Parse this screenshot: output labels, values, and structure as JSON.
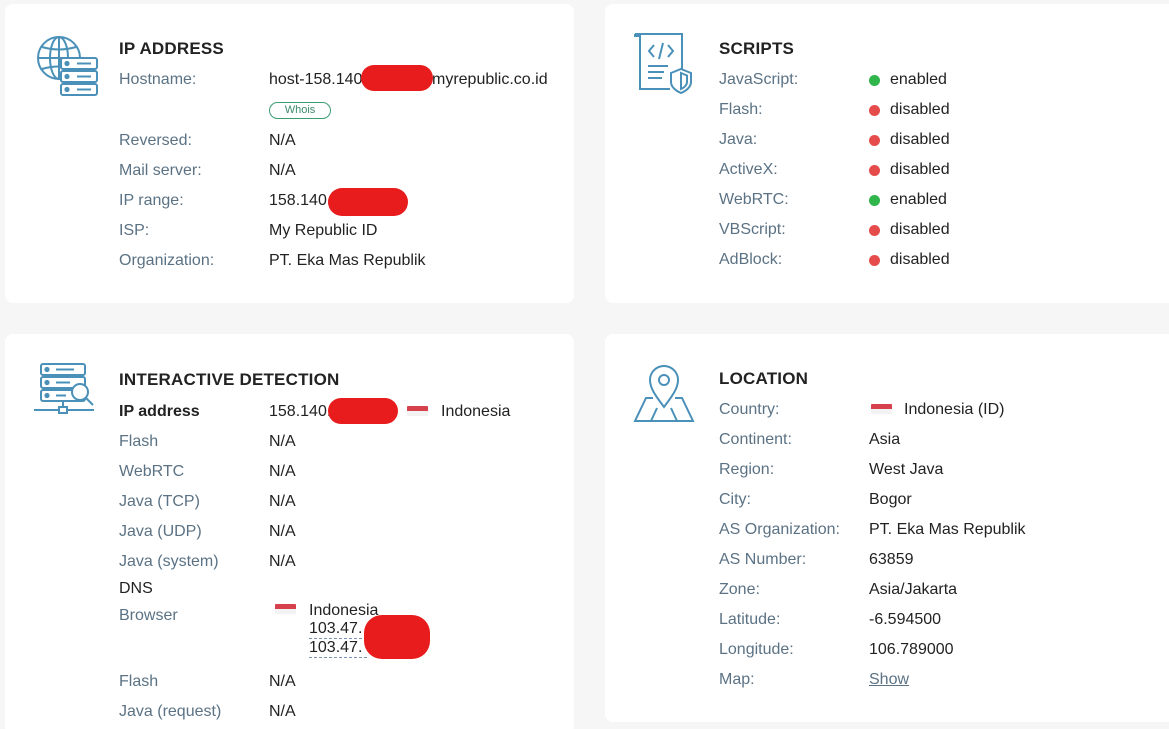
{
  "ip_card": {
    "title": "IP ADDRESS",
    "hostname_label": "Hostname:",
    "hostname_prefix": "host-158.140",
    "hostname_suffix": "myrepublic.co.id",
    "whois_label": "Whois",
    "reversed_label": "Reversed:",
    "reversed_value": "N/A",
    "mail_label": "Mail server:",
    "mail_value": "N/A",
    "range_label": "IP range:",
    "range_prefix": "158.140.",
    "isp_label": "ISP:",
    "isp_value": "My Republic ID",
    "org_label": "Organization:",
    "org_value": "PT. Eka Mas Republik",
    "icon": "globe-server-icon"
  },
  "scripts_card": {
    "title": "SCRIPTS",
    "icon": "code-document-shield-icon",
    "items": [
      {
        "label": "JavaScript:",
        "status": "enabled",
        "on": true
      },
      {
        "label": "Flash:",
        "status": "disabled",
        "on": false
      },
      {
        "label": "Java:",
        "status": "disabled",
        "on": false
      },
      {
        "label": "ActiveX:",
        "status": "disabled",
        "on": false
      },
      {
        "label": "WebRTC:",
        "status": "enabled",
        "on": true
      },
      {
        "label": "VBScript:",
        "status": "disabled",
        "on": false
      },
      {
        "label": "AdBlock:",
        "status": "disabled",
        "on": false
      }
    ],
    "enabled_color": "#2fb54a",
    "disabled_color": "#e64b4b"
  },
  "detection_card": {
    "title": "INTERACTIVE DETECTION",
    "icon": "server-search-icon",
    "ip_label": "IP address",
    "ip_prefix": "158.140.",
    "ip_country": "Indonesia",
    "flash_label": "Flash",
    "flash_value": "N/A",
    "webrtc_label": "WebRTC",
    "webrtc_value": "N/A",
    "java_tcp_label": "Java (TCP)",
    "java_tcp_value": "N/A",
    "java_udp_label": "Java (UDP)",
    "java_udp_value": "N/A",
    "java_system_label": "Java (system)",
    "java_system_value": "N/A",
    "dns_label": "DNS",
    "browser_label": "Browser",
    "browser_country": "Indonesia",
    "browser_ip1_prefix": "103.47.",
    "browser_ip2_prefix": "103.47.",
    "dns_flash_label": "Flash",
    "dns_flash_value": "N/A",
    "java_request_label": "Java (request)",
    "java_request_value": "N/A"
  },
  "location_card": {
    "title": "LOCATION",
    "icon": "map-pin-icon",
    "country_label": "Country:",
    "country_value": "Indonesia (ID)",
    "continent_label": "Continent:",
    "continent_value": "Asia",
    "region_label": "Region:",
    "region_value": "West Java",
    "city_label": "City:",
    "city_value": "Bogor",
    "as_org_label": "AS Organization:",
    "as_org_value": "PT. Eka Mas Republik",
    "as_number_label": "AS Number:",
    "as_number_value": "63859",
    "zone_label": "Zone:",
    "zone_value": "Asia/Jakarta",
    "lat_label": "Latitude:",
    "lat_value": "-6.594500",
    "lon_label": "Longitude:",
    "lon_value": "106.789000",
    "map_label": "Map:",
    "map_link": "Show"
  },
  "colors": {
    "icon_blue": "#4a90b8",
    "label_gray": "#5b7284",
    "redaction_red": "#e81c1c",
    "flag_red": "#d5414c"
  }
}
